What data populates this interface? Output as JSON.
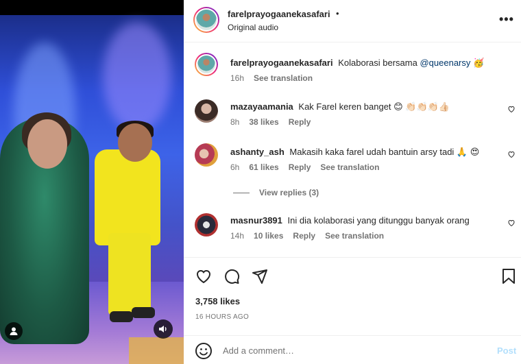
{
  "post": {
    "author": "farelprayogaanekasafari",
    "separator": "•",
    "audio": "Original audio",
    "more": "•••"
  },
  "caption": {
    "author": "farelprayogaanekasafari",
    "text": "Kolaborasi bersama",
    "mention": "@queenarsy",
    "emoji": "🥳",
    "time": "16h",
    "translate": "See translation"
  },
  "comments": [
    {
      "user": "mazayaamania",
      "text": "Kak Farel keren banget 😊 👏🏻👏🏻👏🏻👍🏻",
      "time": "8h",
      "likes": "38 likes",
      "reply": "Reply",
      "translate": ""
    },
    {
      "user": "ashanty_ash",
      "text": "Makasih kaka farel udah bantuin arsy tadi 🙏 😍",
      "time": "6h",
      "likes": "61 likes",
      "reply": "Reply",
      "translate": "See translation"
    },
    {
      "user": "masnur3891",
      "text": "Ini dia kolaborasi yang ditunggu banyak orang",
      "time": "14h",
      "likes": "10 likes",
      "reply": "Reply",
      "translate": "See translation"
    }
  ],
  "view_replies": "View replies (3)",
  "stats": {
    "likes": "3,758 likes",
    "time": "16 HOURS AGO"
  },
  "composer": {
    "placeholder": "Add a comment…",
    "post_label": "Post"
  },
  "icons": {
    "heart": "heart-icon",
    "comment": "comment-icon",
    "share": "share-icon",
    "save": "bookmark-icon",
    "emoji": "emoji-icon",
    "volume": "volume-icon",
    "user": "user-tag-icon"
  },
  "colors": {
    "link": "#00376b",
    "post_button": "#b2dffc",
    "muted": "#737373"
  }
}
